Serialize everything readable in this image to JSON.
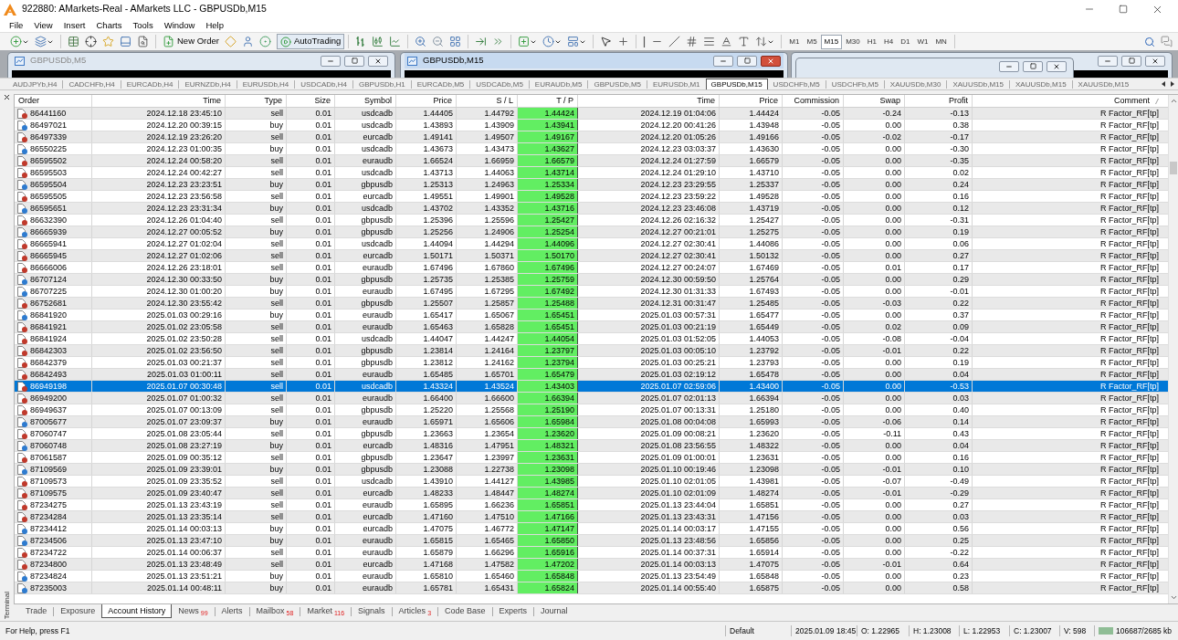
{
  "window": {
    "title": "922880: AMarkets-Real - AMarkets LLC - GBPUSDb,M15"
  },
  "menu": [
    "File",
    "View",
    "Insert",
    "Charts",
    "Tools",
    "Window",
    "Help"
  ],
  "toolbar": {
    "new_order": "New Order",
    "auto_trading": "AutoTrading",
    "timeframes": [
      {
        "label": "M1",
        "selected": false
      },
      {
        "label": "M5",
        "selected": false
      },
      {
        "label": "M15",
        "selected": true
      },
      {
        "label": "M30",
        "selected": false
      },
      {
        "label": "H1",
        "selected": false
      },
      {
        "label": "H4",
        "selected": false
      },
      {
        "label": "D1",
        "selected": false
      },
      {
        "label": "W1",
        "selected": false
      },
      {
        "label": "MN",
        "selected": false
      }
    ]
  },
  "chart_windows": [
    {
      "title": "GBPUSDb,M5",
      "active": false
    },
    {
      "title": "GBPUSDb,M15",
      "active": true
    }
  ],
  "chart_tabs": [
    {
      "label": "AUDJPYb,H4",
      "selected": false
    },
    {
      "label": "CADCHFb,H4",
      "selected": false
    },
    {
      "label": "EURCADb,H4",
      "selected": false
    },
    {
      "label": "EURNZDb,H4",
      "selected": false
    },
    {
      "label": "EURUSDb,H4",
      "selected": false
    },
    {
      "label": "USDCADb,H4",
      "selected": false
    },
    {
      "label": "GBPUSDb,H1",
      "selected": false
    },
    {
      "label": "EURCADb,M5",
      "selected": false
    },
    {
      "label": "USDCADb,M5",
      "selected": false
    },
    {
      "label": "EURAUDb,M5",
      "selected": false
    },
    {
      "label": "GBPUSDb,M5",
      "selected": false
    },
    {
      "label": "EURUSDb,M1",
      "selected": false
    },
    {
      "label": "GBPUSDb,M15",
      "selected": true
    },
    {
      "label": "USDCHFb,M5",
      "selected": false
    },
    {
      "label": "USDCHFb,M5",
      "selected": false
    },
    {
      "label": "XAUUSDb,M30",
      "selected": false
    },
    {
      "label": "XAUUSDb,M15",
      "selected": false
    },
    {
      "label": "XAUUSDb,M15",
      "selected": false
    },
    {
      "label": "XAUUSDb,M15",
      "selected": false
    }
  ],
  "terminal": {
    "label": "Terminal",
    "columns": [
      "Order",
      "Time",
      "Type",
      "Size",
      "Symbol",
      "Price",
      "S / L",
      "T / P",
      "Time",
      "Price",
      "Commission",
      "Swap",
      "Profit",
      "Comment"
    ],
    "rows": [
      {
        "cells": [
          "86441160",
          "2024.12.18 23:45:10",
          "sell",
          "0.01",
          "usdcadb",
          "1.44405",
          "1.44792",
          "1.44424",
          "2024.12.19 01:04:06",
          "1.44424",
          "-0.05",
          "-0.24",
          "-0.13",
          "R Factor_RF[tp]"
        ],
        "color": "#c0392b",
        "tp_hit": true,
        "selected": false
      },
      {
        "cells": [
          "86497021",
          "2024.12.20 00:39:15",
          "buy",
          "0.01",
          "usdcadb",
          "1.43893",
          "1.43909",
          "1.43941",
          "2024.12.20 00:41:26",
          "1.43948",
          "-0.05",
          "0.00",
          "0.38",
          "R Factor_RF[tp]"
        ],
        "color": "#2e7bcf",
        "tp_hit": true,
        "selected": false
      },
      {
        "cells": [
          "86497339",
          "2024.12.19 23:26:20",
          "sell",
          "0.01",
          "eurcadb",
          "1.49141",
          "1.49507",
          "1.49167",
          "2024.12.20 01:05:26",
          "1.49166",
          "-0.05",
          "-0.02",
          "-0.17",
          "R Factor_RF[tp]"
        ],
        "color": "#c0392b",
        "tp_hit": true,
        "selected": false
      },
      {
        "cells": [
          "86550225",
          "2024.12.23 01:00:35",
          "buy",
          "0.01",
          "usdcadb",
          "1.43673",
          "1.43473",
          "1.43627",
          "2024.12.23 03:03:37",
          "1.43630",
          "-0.05",
          "0.00",
          "-0.30",
          "R Factor_RF[tp]"
        ],
        "color": "#2e7bcf",
        "tp_hit": true,
        "selected": false
      },
      {
        "cells": [
          "86595502",
          "2024.12.24 00:58:20",
          "sell",
          "0.01",
          "euraudb",
          "1.66524",
          "1.66959",
          "1.66579",
          "2024.12.24 01:27:59",
          "1.66579",
          "-0.05",
          "0.00",
          "-0.35",
          "R Factor_RF[tp]"
        ],
        "color": "#c0392b",
        "tp_hit": true,
        "selected": false
      },
      {
        "cells": [
          "86595503",
          "2024.12.24 00:42:27",
          "sell",
          "0.01",
          "usdcadb",
          "1.43713",
          "1.44063",
          "1.43714",
          "2024.12.24 01:29:10",
          "1.43710",
          "-0.05",
          "0.00",
          "0.02",
          "R Factor_RF[tp]"
        ],
        "color": "#c0392b",
        "tp_hit": true,
        "selected": false
      },
      {
        "cells": [
          "86595504",
          "2024.12.23 23:23:51",
          "buy",
          "0.01",
          "gbpusdb",
          "1.25313",
          "1.24963",
          "1.25334",
          "2024.12.23 23:29:55",
          "1.25337",
          "-0.05",
          "0.00",
          "0.24",
          "R Factor_RF[tp]"
        ],
        "color": "#2e7bcf",
        "tp_hit": true,
        "selected": false
      },
      {
        "cells": [
          "86595505",
          "2024.12.23 23:56:58",
          "sell",
          "0.01",
          "eurcadb",
          "1.49551",
          "1.49901",
          "1.49528",
          "2024.12.23 23:59:22",
          "1.49528",
          "-0.05",
          "0.00",
          "0.16",
          "R Factor_RF[tp]"
        ],
        "color": "#c0392b",
        "tp_hit": true,
        "selected": false
      },
      {
        "cells": [
          "86595651",
          "2024.12.23 23:31:34",
          "buy",
          "0.01",
          "usdcadb",
          "1.43702",
          "1.43352",
          "1.43716",
          "2024.12.23 23:46:08",
          "1.43719",
          "-0.05",
          "0.00",
          "0.12",
          "R Factor_RF[tp]"
        ],
        "color": "#2e7bcf",
        "tp_hit": true,
        "selected": false
      },
      {
        "cells": [
          "86632390",
          "2024.12.26 01:04:40",
          "sell",
          "0.01",
          "gbpusdb",
          "1.25396",
          "1.25596",
          "1.25427",
          "2024.12.26 02:16:32",
          "1.25427",
          "-0.05",
          "0.00",
          "-0.31",
          "R Factor_RF[tp]"
        ],
        "color": "#c0392b",
        "tp_hit": true,
        "selected": false
      },
      {
        "cells": [
          "86665939",
          "2024.12.27 00:05:52",
          "buy",
          "0.01",
          "gbpusdb",
          "1.25256",
          "1.24906",
          "1.25254",
          "2024.12.27 00:21:01",
          "1.25275",
          "-0.05",
          "0.00",
          "0.19",
          "R Factor_RF[tp]"
        ],
        "color": "#2e7bcf",
        "tp_hit": true,
        "selected": false
      },
      {
        "cells": [
          "86665941",
          "2024.12.27 01:02:04",
          "sell",
          "0.01",
          "usdcadb",
          "1.44094",
          "1.44294",
          "1.44096",
          "2024.12.27 02:30:41",
          "1.44086",
          "-0.05",
          "0.00",
          "0.06",
          "R Factor_RF[tp]"
        ],
        "color": "#c0392b",
        "tp_hit": true,
        "selected": false
      },
      {
        "cells": [
          "86665945",
          "2024.12.27 01:02:06",
          "sell",
          "0.01",
          "eurcadb",
          "1.50171",
          "1.50371",
          "1.50170",
          "2024.12.27 02:30:41",
          "1.50132",
          "-0.05",
          "0.00",
          "0.27",
          "R Factor_RF[tp]"
        ],
        "color": "#c0392b",
        "tp_hit": true,
        "selected": false
      },
      {
        "cells": [
          "86666006",
          "2024.12.26 23:18:01",
          "sell",
          "0.01",
          "euraudb",
          "1.67496",
          "1.67860",
          "1.67496",
          "2024.12.27 00:24:07",
          "1.67469",
          "-0.05",
          "0.01",
          "0.17",
          "R Factor_RF[tp]"
        ],
        "color": "#c0392b",
        "tp_hit": true,
        "selected": false
      },
      {
        "cells": [
          "86707124",
          "2024.12.30 00:33:50",
          "buy",
          "0.01",
          "gbpusdb",
          "1.25735",
          "1.25385",
          "1.25759",
          "2024.12.30 00:59:50",
          "1.25764",
          "-0.05",
          "0.00",
          "0.29",
          "R Factor_RF[tp]"
        ],
        "color": "#2e7bcf",
        "tp_hit": true,
        "selected": false
      },
      {
        "cells": [
          "86707225",
          "2024.12.30 01:00:20",
          "buy",
          "0.01",
          "euraudb",
          "1.67495",
          "1.67295",
          "1.67492",
          "2024.12.30 01:31:33",
          "1.67493",
          "-0.05",
          "0.00",
          "-0.01",
          "R Factor_RF[tp]"
        ],
        "color": "#2e7bcf",
        "tp_hit": true,
        "selected": false
      },
      {
        "cells": [
          "86752681",
          "2024.12.30 23:55:42",
          "sell",
          "0.01",
          "gbpusdb",
          "1.25507",
          "1.25857",
          "1.25488",
          "2024.12.31 00:31:47",
          "1.25485",
          "-0.05",
          "-0.03",
          "0.22",
          "R Factor_RF[tp]"
        ],
        "color": "#c0392b",
        "tp_hit": true,
        "selected": false
      },
      {
        "cells": [
          "86841920",
          "2025.01.03 00:29:16",
          "buy",
          "0.01",
          "euraudb",
          "1.65417",
          "1.65067",
          "1.65451",
          "2025.01.03 00:57:31",
          "1.65477",
          "-0.05",
          "0.00",
          "0.37",
          "R Factor_RF[tp]"
        ],
        "color": "#2e7bcf",
        "tp_hit": true,
        "selected": false
      },
      {
        "cells": [
          "86841921",
          "2025.01.02 23:05:58",
          "sell",
          "0.01",
          "euraudb",
          "1.65463",
          "1.65828",
          "1.65451",
          "2025.01.03 00:21:19",
          "1.65449",
          "-0.05",
          "0.02",
          "0.09",
          "R Factor_RF[tp]"
        ],
        "color": "#c0392b",
        "tp_hit": true,
        "selected": false
      },
      {
        "cells": [
          "86841924",
          "2025.01.02 23:50:28",
          "sell",
          "0.01",
          "usdcadb",
          "1.44047",
          "1.44247",
          "1.44054",
          "2025.01.03 01:52:05",
          "1.44053",
          "-0.05",
          "-0.08",
          "-0.04",
          "R Factor_RF[tp]"
        ],
        "color": "#c0392b",
        "tp_hit": true,
        "selected": false
      },
      {
        "cells": [
          "86842303",
          "2025.01.02 23:56:50",
          "sell",
          "0.01",
          "gbpusdb",
          "1.23814",
          "1.24164",
          "1.23797",
          "2025.01.03 00:05:10",
          "1.23792",
          "-0.05",
          "-0.01",
          "0.22",
          "R Factor_RF[tp]"
        ],
        "color": "#c0392b",
        "tp_hit": true,
        "selected": false
      },
      {
        "cells": [
          "86842379",
          "2025.01.03 00:21:37",
          "sell",
          "0.01",
          "gbpusdb",
          "1.23812",
          "1.24162",
          "1.23794",
          "2025.01.03 00:25:21",
          "1.23793",
          "-0.05",
          "0.00",
          "0.19",
          "R Factor_RF[tp]"
        ],
        "color": "#c0392b",
        "tp_hit": true,
        "selected": false
      },
      {
        "cells": [
          "86842493",
          "2025.01.03 01:00:11",
          "sell",
          "0.01",
          "euraudb",
          "1.65485",
          "1.65701",
          "1.65479",
          "2025.01.03 02:19:12",
          "1.65478",
          "-0.05",
          "0.00",
          "0.04",
          "R Factor_RF[tp]"
        ],
        "color": "#c0392b",
        "tp_hit": true,
        "selected": false
      },
      {
        "cells": [
          "86949198",
          "2025.01.07 00:30:48",
          "sell",
          "0.01",
          "usdcadb",
          "1.43324",
          "1.43524",
          "1.43403",
          "2025.01.07 02:59:06",
          "1.43400",
          "-0.05",
          "0.00",
          "-0.53",
          "R Factor_RF[tp]"
        ],
        "color": "#c0392b",
        "tp_hit": true,
        "selected": true
      },
      {
        "cells": [
          "86949200",
          "2025.01.07 01:00:32",
          "sell",
          "0.01",
          "euraudb",
          "1.66400",
          "1.66600",
          "1.66394",
          "2025.01.07 02:01:13",
          "1.66394",
          "-0.05",
          "0.00",
          "0.03",
          "R Factor_RF[tp]"
        ],
        "color": "#c0392b",
        "tp_hit": true,
        "selected": false
      },
      {
        "cells": [
          "86949637",
          "2025.01.07 00:13:09",
          "sell",
          "0.01",
          "gbpusdb",
          "1.25220",
          "1.25568",
          "1.25190",
          "2025.01.07 00:13:31",
          "1.25180",
          "-0.05",
          "0.00",
          "0.40",
          "R Factor_RF[tp]"
        ],
        "color": "#c0392b",
        "tp_hit": true,
        "selected": false
      },
      {
        "cells": [
          "87005677",
          "2025.01.07 23:09:37",
          "buy",
          "0.01",
          "euraudb",
          "1.65971",
          "1.65606",
          "1.65984",
          "2025.01.08 00:04:08",
          "1.65993",
          "-0.05",
          "-0.06",
          "0.14",
          "R Factor_RF[tp]"
        ],
        "color": "#2e7bcf",
        "tp_hit": true,
        "selected": false
      },
      {
        "cells": [
          "87060747",
          "2025.01.08 23:05:44",
          "sell",
          "0.01",
          "gbpusdb",
          "1.23663",
          "1.23654",
          "1.23620",
          "2025.01.09 00:08:21",
          "1.23620",
          "-0.05",
          "-0.11",
          "0.43",
          "R Factor_RF[tp]"
        ],
        "color": "#c0392b",
        "tp_hit": true,
        "selected": false
      },
      {
        "cells": [
          "87060748",
          "2025.01.08 23:27:19",
          "buy",
          "0.01",
          "eurcadb",
          "1.48316",
          "1.47951",
          "1.48321",
          "2025.01.08 23:56:55",
          "1.48322",
          "-0.05",
          "0.00",
          "0.04",
          "R Factor_RF[tp]"
        ],
        "color": "#2e7bcf",
        "tp_hit": true,
        "selected": false
      },
      {
        "cells": [
          "87061587",
          "2025.01.09 00:35:12",
          "sell",
          "0.01",
          "gbpusdb",
          "1.23647",
          "1.23997",
          "1.23631",
          "2025.01.09 01:00:01",
          "1.23631",
          "-0.05",
          "0.00",
          "0.16",
          "R Factor_RF[tp]"
        ],
        "color": "#c0392b",
        "tp_hit": true,
        "selected": false
      },
      {
        "cells": [
          "87109569",
          "2025.01.09 23:39:01",
          "buy",
          "0.01",
          "gbpusdb",
          "1.23088",
          "1.22738",
          "1.23098",
          "2025.01.10 00:19:46",
          "1.23098",
          "-0.05",
          "-0.01",
          "0.10",
          "R Factor_RF[tp]"
        ],
        "color": "#2e7bcf",
        "tp_hit": true,
        "selected": false
      },
      {
        "cells": [
          "87109573",
          "2025.01.09 23:35:52",
          "sell",
          "0.01",
          "usdcadb",
          "1.43910",
          "1.44127",
          "1.43985",
          "2025.01.10 02:01:05",
          "1.43981",
          "-0.05",
          "-0.07",
          "-0.49",
          "R Factor_RF[tp]"
        ],
        "color": "#c0392b",
        "tp_hit": true,
        "selected": false
      },
      {
        "cells": [
          "87109575",
          "2025.01.09 23:40:47",
          "sell",
          "0.01",
          "eurcadb",
          "1.48233",
          "1.48447",
          "1.48274",
          "2025.01.10 02:01:09",
          "1.48274",
          "-0.05",
          "-0.01",
          "-0.29",
          "R Factor_RF[tp]"
        ],
        "color": "#c0392b",
        "tp_hit": true,
        "selected": false
      },
      {
        "cells": [
          "87234275",
          "2025.01.13 23:43:19",
          "sell",
          "0.01",
          "euraudb",
          "1.65895",
          "1.66236",
          "1.65851",
          "2025.01.13 23:44:04",
          "1.65851",
          "-0.05",
          "0.00",
          "0.27",
          "R Factor_RF[tp]"
        ],
        "color": "#c0392b",
        "tp_hit": true,
        "selected": false
      },
      {
        "cells": [
          "87234284",
          "2025.01.13 23:35:14",
          "sell",
          "0.01",
          "eurcadb",
          "1.47160",
          "1.47510",
          "1.47166",
          "2025.01.13 23:43:31",
          "1.47156",
          "-0.05",
          "0.00",
          "0.03",
          "R Factor_RF[tp]"
        ],
        "color": "#c0392b",
        "tp_hit": true,
        "selected": false
      },
      {
        "cells": [
          "87234412",
          "2025.01.14 00:03:13",
          "buy",
          "0.01",
          "eurcadb",
          "1.47075",
          "1.46772",
          "1.47147",
          "2025.01.14 00:03:17",
          "1.47155",
          "-0.05",
          "0.00",
          "0.56",
          "R Factor_RF[tp]"
        ],
        "color": "#2e7bcf",
        "tp_hit": true,
        "selected": false
      },
      {
        "cells": [
          "87234506",
          "2025.01.13 23:47:10",
          "buy",
          "0.01",
          "euraudb",
          "1.65815",
          "1.65465",
          "1.65850",
          "2025.01.13 23:48:56",
          "1.65856",
          "-0.05",
          "0.00",
          "0.25",
          "R Factor_RF[tp]"
        ],
        "color": "#2e7bcf",
        "tp_hit": true,
        "selected": false
      },
      {
        "cells": [
          "87234722",
          "2025.01.14 00:06:37",
          "sell",
          "0.01",
          "euraudb",
          "1.65879",
          "1.66296",
          "1.65916",
          "2025.01.14 00:37:31",
          "1.65914",
          "-0.05",
          "0.00",
          "-0.22",
          "R Factor_RF[tp]"
        ],
        "color": "#c0392b",
        "tp_hit": true,
        "selected": false
      },
      {
        "cells": [
          "87234800",
          "2025.01.13 23:48:49",
          "sell",
          "0.01",
          "eurcadb",
          "1.47168",
          "1.47582",
          "1.47202",
          "2025.01.14 00:03:13",
          "1.47075",
          "-0.05",
          "-0.01",
          "0.64",
          "R Factor_RF[tp]"
        ],
        "color": "#c0392b",
        "tp_hit": true,
        "selected": false
      },
      {
        "cells": [
          "87234824",
          "2025.01.13 23:51:21",
          "buy",
          "0.01",
          "euraudb",
          "1.65810",
          "1.65460",
          "1.65848",
          "2025.01.13 23:54:49",
          "1.65848",
          "-0.05",
          "0.00",
          "0.23",
          "R Factor_RF[tp]"
        ],
        "color": "#2e7bcf",
        "tp_hit": true,
        "selected": false
      },
      {
        "cells": [
          "87235003",
          "2025.01.14 00:48:11",
          "buy",
          "0.01",
          "euraudb",
          "1.65781",
          "1.65431",
          "1.65824",
          "2025.01.14 00:55:40",
          "1.65875",
          "-0.05",
          "0.00",
          "0.58",
          "R Factor_RF[tp]"
        ],
        "color": "#2e7bcf",
        "tp_hit": true,
        "selected": false
      }
    ],
    "tabs": [
      {
        "label": "Trade",
        "selected": false
      },
      {
        "label": "Exposure",
        "selected": false
      },
      {
        "label": "Account History",
        "selected": true
      },
      {
        "label": "News",
        "count": "99",
        "selected": false
      },
      {
        "label": "Alerts",
        "selected": false
      },
      {
        "label": "Mailbox",
        "count": "58",
        "selected": false
      },
      {
        "label": "Market",
        "count": "116",
        "selected": false
      },
      {
        "label": "Signals",
        "selected": false
      },
      {
        "label": "Articles",
        "count": "3",
        "selected": false
      },
      {
        "label": "Code Base",
        "selected": false
      },
      {
        "label": "Experts",
        "selected": false
      },
      {
        "label": "Journal",
        "selected": false
      }
    ]
  },
  "status_bar": {
    "help": "For Help, press F1",
    "profile": "Default",
    "datetime": "2025.01.09 18:45",
    "open": "O: 1.22965",
    "high": "H: 1.23008",
    "low": "L: 1.22953",
    "close": "C: 1.23007",
    "volume": "V: 598",
    "traffic": "106687/2685 kb"
  }
}
